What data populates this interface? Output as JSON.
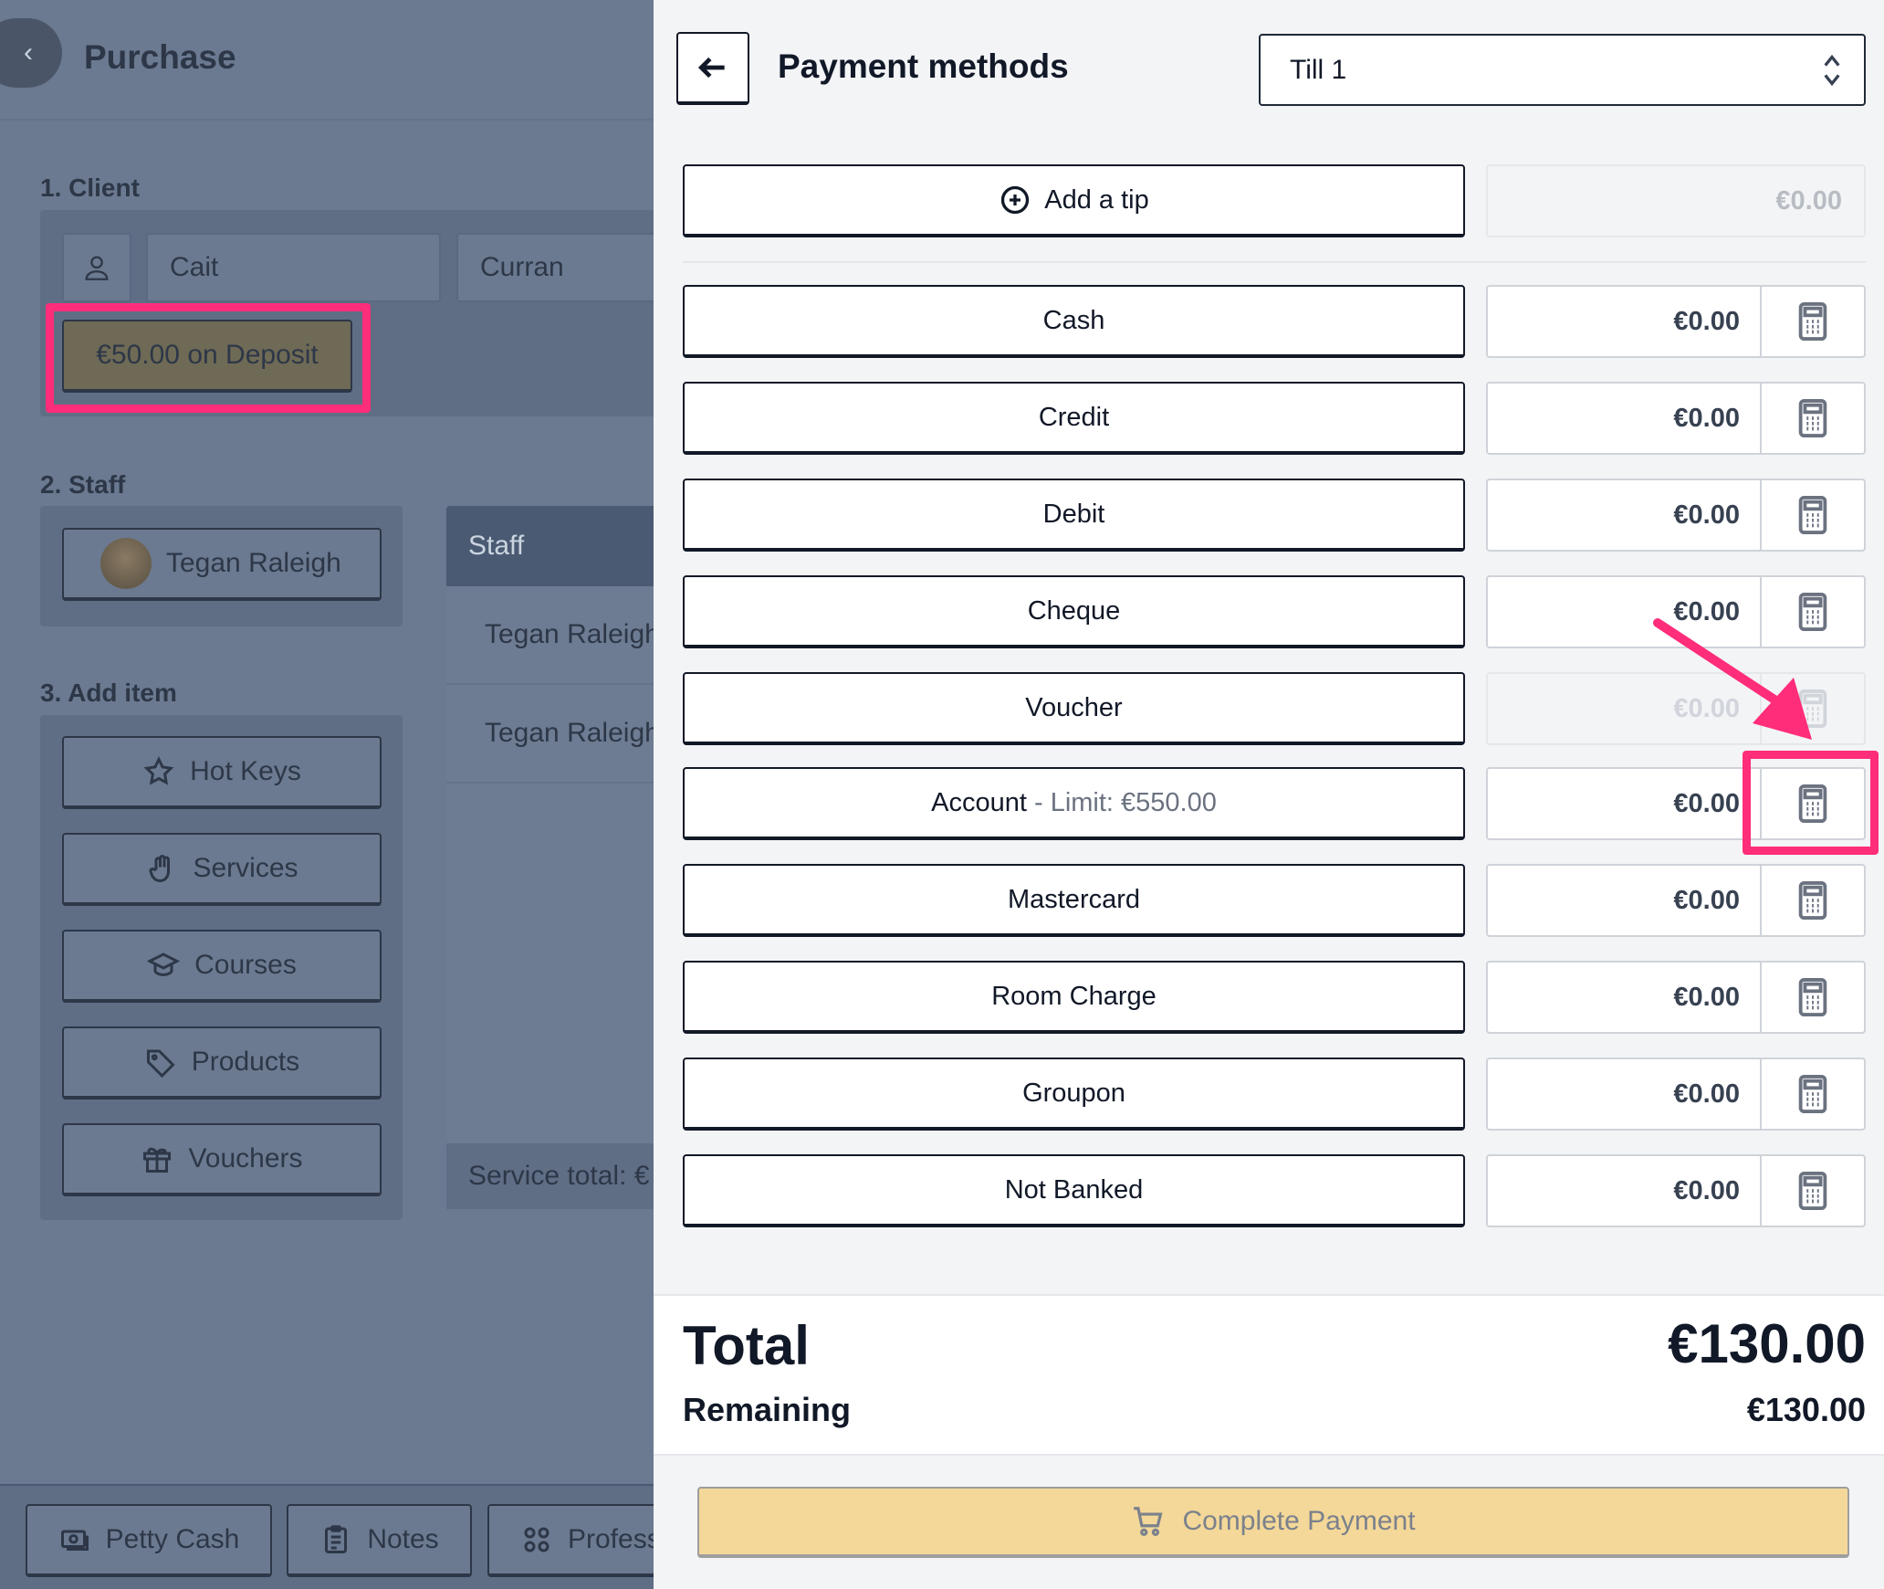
{
  "left": {
    "title": "Purchase",
    "back_icon": "‹",
    "section_client": "1. Client",
    "client_first": "Cait",
    "client_last": "Curran",
    "deposit": "€50.00 on Deposit",
    "section_staff": "2. Staff",
    "staff_selected": "Tegan Raleigh",
    "staff_header": "Staff",
    "staff_rows": [
      "Tegan Raleigh",
      "Tegan Raleigh"
    ],
    "service_total": "Service total: €",
    "section_add": "3. Add item",
    "add_items": [
      "Hot Keys",
      "Services",
      "Courses",
      "Products",
      "Vouchers"
    ],
    "footer": [
      "Petty Cash",
      "Notes",
      "Profess"
    ]
  },
  "right": {
    "title": "Payment methods",
    "till": "Till 1",
    "tip_label": "Add a tip",
    "tip_amount": "€0.00",
    "methods": [
      {
        "label": "Cash",
        "amount": "€0.00"
      },
      {
        "label": "Credit",
        "amount": "€0.00"
      },
      {
        "label": "Debit",
        "amount": "€0.00"
      },
      {
        "label": "Cheque",
        "amount": "€0.00"
      },
      {
        "label": "Voucher",
        "amount": "€0.00"
      },
      {
        "label": "Account",
        "sep": " - ",
        "extra": "Limit: €550.00",
        "amount": "€0.00"
      },
      {
        "label": "Mastercard",
        "amount": "€0.00"
      },
      {
        "label": "Room Charge",
        "amount": "€0.00"
      },
      {
        "label": "Groupon",
        "amount": "€0.00"
      },
      {
        "label": "Not Banked",
        "amount": "€0.00"
      }
    ],
    "total_label": "Total",
    "total_value": "€130.00",
    "remaining_label": "Remaining",
    "remaining_value": "€130.00",
    "complete_label": "Complete Payment"
  },
  "colors": {
    "highlight": "#ff2d7a",
    "complete_bg": "#f4d899",
    "overlay": "#6b7a90"
  }
}
